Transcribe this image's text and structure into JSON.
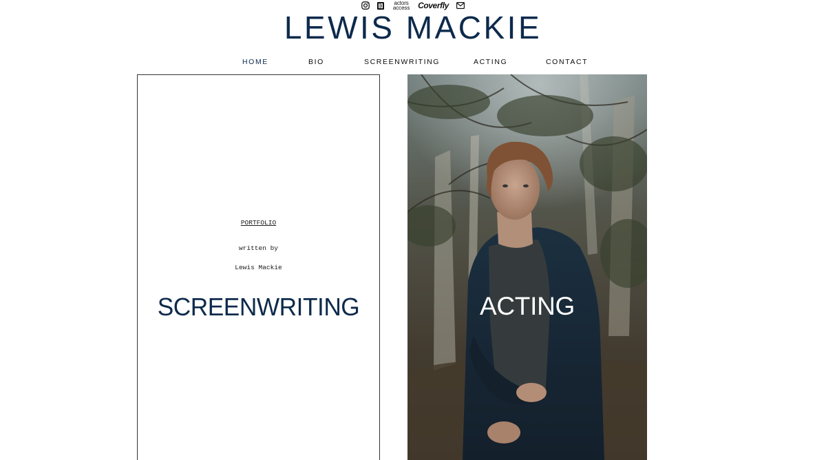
{
  "social": {
    "instagram_icon": "instagram-icon",
    "imdb_icon": "imdb-icon",
    "actors_access": {
      "line1": "actors",
      "line2": "access"
    },
    "coverfly": "Coverfly",
    "email_icon": "envelope-icon"
  },
  "site": {
    "title": "LEWIS MACKIE"
  },
  "nav": {
    "items": [
      "HOME",
      "BIO",
      "SCREENWRITING",
      "ACTING",
      "CONTACT"
    ],
    "active": "HOME"
  },
  "screenwriting_panel": {
    "script_title": "PORTFOLIO",
    "written_by": "written by",
    "author": "Lewis Mackie",
    "label": "SCREENWRITING"
  },
  "acting_panel": {
    "label": "ACTING"
  },
  "colors": {
    "brand_navy": "#0d2a4c",
    "text_black": "#0a0a0a",
    "background": "#ffffff"
  }
}
